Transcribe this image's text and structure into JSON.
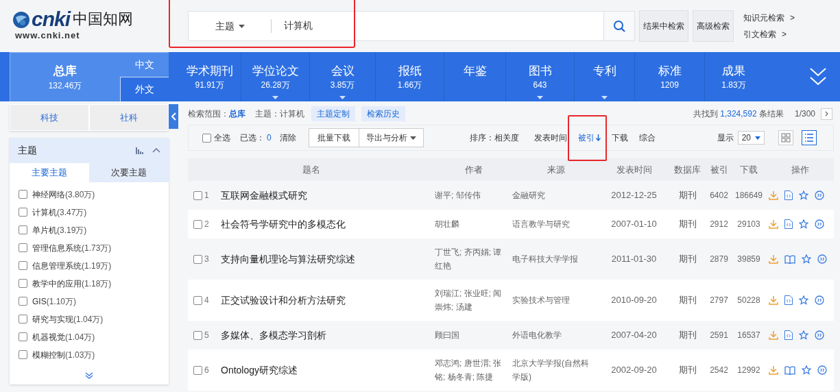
{
  "logo": {
    "mark": "cnki",
    "name": "中国知网",
    "url": "www.cnki.net"
  },
  "search": {
    "field": "主题",
    "value": "计算机",
    "highlighted": true
  },
  "header_buttons": [
    "结果中检索",
    "高级检索"
  ],
  "header_links": [
    {
      "label": "知识元检索",
      "arrow": ">"
    },
    {
      "label": "引文检索",
      "arrow": ">"
    }
  ],
  "database_nav": {
    "all": {
      "label": "总库",
      "count": "132.46万"
    },
    "languages": [
      "中文",
      "外文"
    ],
    "items": [
      {
        "label": "学术期刊",
        "count": "91.91万",
        "has_menu": false
      },
      {
        "label": "学位论文",
        "count": "26.28万",
        "has_menu": true
      },
      {
        "label": "会议",
        "count": "3.85万",
        "has_menu": true
      },
      {
        "label": "报纸",
        "count": "1.66万",
        "has_menu": false
      },
      {
        "label": "年鉴",
        "has_menu": false
      },
      {
        "label": "图书",
        "count": "643",
        "has_menu": true
      },
      {
        "label": "专利",
        "has_menu": true
      },
      {
        "label": "标准",
        "count": "1209",
        "has_menu": false
      },
      {
        "label": "成果",
        "count": "1.83万",
        "has_menu": false
      }
    ]
  },
  "sidebar": {
    "tabs": [
      "科技",
      "社科"
    ],
    "facet": {
      "title": "主题",
      "subtabs": [
        {
          "label": "主要主题",
          "selected": true
        },
        {
          "label": "次要主题",
          "selected": false
        }
      ],
      "items": [
        {
          "label": "神经网络",
          "count": "(3.80万)",
          "checked": false
        },
        {
          "label": "计算机",
          "count": "(3.47万)",
          "checked": false
        },
        {
          "label": "单片机",
          "count": "(3.19万)",
          "checked": false
        },
        {
          "label": "管理信息系统",
          "count": "(1.73万)",
          "checked": false
        },
        {
          "label": "信息管理系统",
          "count": "(1.19万)",
          "checked": false
        },
        {
          "label": "教学中的应用",
          "count": "(1.18万)",
          "checked": false
        },
        {
          "label": "GIS",
          "count": "(1.10万)",
          "checked": false
        },
        {
          "label": "研究与实现",
          "count": "(1.04万)",
          "checked": false
        },
        {
          "label": "机器视觉",
          "count": "(1.04万)",
          "checked": false
        },
        {
          "label": "模糊控制",
          "count": "(1.03万)",
          "checked": false
        }
      ]
    }
  },
  "scope": {
    "label": "检索范围：",
    "value": "总库",
    "query": "主题：计算机",
    "buttons": [
      "主题定制",
      "检索历史"
    ]
  },
  "results": {
    "prefix": "共找到",
    "count": "1,324,592",
    "suffix": "条结果",
    "page": "1/300"
  },
  "toolbar": {
    "select_all": {
      "label": "全选",
      "checked": false
    },
    "selected_label": "已选：",
    "selected_count": "0",
    "clear": "清除",
    "batch_download": "批量下载",
    "export": "导出与分析",
    "sort_label": "排序：",
    "sorts": [
      {
        "label": "相关度",
        "selected": false,
        "highlighted": false
      },
      {
        "label": "发表时间",
        "selected": false,
        "highlighted": false
      },
      {
        "label": "被引",
        "selected": true,
        "highlighted": true
      },
      {
        "label": "下载",
        "selected": false,
        "highlighted": false
      },
      {
        "label": "综合",
        "selected": false,
        "highlighted": false
      }
    ],
    "page_size_label": "显示",
    "page_size": "20",
    "view": {
      "grid_selected": false,
      "list_selected": true
    }
  },
  "table": {
    "columns": [
      "题名",
      "作者",
      "来源",
      "发表时间",
      "数据库",
      "被引",
      "下载",
      "操作"
    ],
    "rows": [
      {
        "index": "1",
        "title": "互联网金融模式研究",
        "authors": "谢平; 邹传伟",
        "source": "金融研究",
        "date": "2012-12-25",
        "database": "期刊",
        "cited": "6402",
        "downloads": "186649",
        "kind": "html",
        "checked": false
      },
      {
        "index": "2",
        "title": "社会符号学研究中的多模态化",
        "authors": "胡壮麟",
        "source": "语言教学与研究",
        "date": "2007-01-10",
        "database": "期刊",
        "cited": "2912",
        "downloads": "29103",
        "kind": "html",
        "checked": false
      },
      {
        "index": "3",
        "title": "支持向量机理论与算法研究综述",
        "authors": "丁世飞; 齐丙娟; 谭红艳",
        "source": "电子科技大学学报",
        "date": "2011-01-30",
        "database": "期刊",
        "cited": "2879",
        "downloads": "39859",
        "kind": "book",
        "checked": false
      },
      {
        "index": "4",
        "title": "正交试验设计和分析方法研究",
        "authors": "刘瑞江; 张业旺; 闻崇炜; 汤建",
        "source": "实验技术与管理",
        "date": "2010-09-20",
        "database": "期刊",
        "cited": "2797",
        "downloads": "50228",
        "kind": "html",
        "checked": false
      },
      {
        "index": "5",
        "title": "多媒体、多模态学习剖析",
        "authors": "顾曰国",
        "source": "外语电化教学",
        "date": "2007-04-20",
        "database": "期刊",
        "cited": "2591",
        "downloads": "16537",
        "kind": "html",
        "checked": false
      },
      {
        "index": "6",
        "title": "Ontology研究综述",
        "authors": "邓志鸿; 唐世渭; 张铭; 杨冬青; 陈捷",
        "source": "北京大学学报(自然科学版)",
        "date": "2002-09-20",
        "database": "期刊",
        "cited": "2542",
        "downloads": "12992",
        "kind": "book",
        "checked": false
      }
    ]
  }
}
